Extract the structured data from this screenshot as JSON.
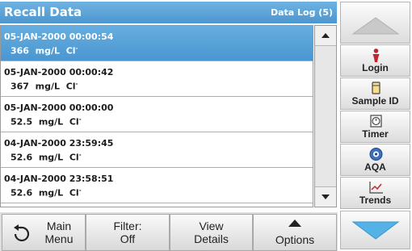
{
  "header": {
    "title": "Recall Data",
    "right_label": "Data Log (5)"
  },
  "records": [
    {
      "timestamp": "05-JAN-2000  00:00:54",
      "value": "366",
      "unit": "mg/L",
      "param": "Cl",
      "charge": "-",
      "selected": true
    },
    {
      "timestamp": "05-JAN-2000  00:00:42",
      "value": "367",
      "unit": "mg/L",
      "param": "Cl",
      "charge": "-",
      "selected": false
    },
    {
      "timestamp": "05-JAN-2000  00:00:00",
      "value": "52.5",
      "unit": "mg/L",
      "param": "Cl",
      "charge": "-",
      "selected": false
    },
    {
      "timestamp": "04-JAN-2000  23:59:45",
      "value": "52.6",
      "unit": "mg/L",
      "param": "Cl",
      "charge": "-",
      "selected": false
    },
    {
      "timestamp": "04-JAN-2000  23:58:51",
      "value": "52.6",
      "unit": "mg/L",
      "param": "Cl",
      "charge": "-",
      "selected": false
    }
  ],
  "bottom_bar": {
    "main_menu": [
      "Main",
      "Menu"
    ],
    "filter": [
      "Filter:",
      "Off"
    ],
    "view_details": [
      "View",
      "Details"
    ],
    "options": "Options"
  },
  "side_tools": [
    {
      "label": "Login",
      "icon": "person-icon"
    },
    {
      "label": "Sample ID",
      "icon": "sample-id-icon"
    },
    {
      "label": "Timer",
      "icon": "timer-icon"
    },
    {
      "label": "AQA",
      "icon": "aqa-icon"
    },
    {
      "label": "Trends",
      "icon": "trends-icon"
    }
  ],
  "colors": {
    "accent": "#4c95cf",
    "selected_row": "#5aa3da",
    "nav_arrow": "#55b2e6"
  }
}
